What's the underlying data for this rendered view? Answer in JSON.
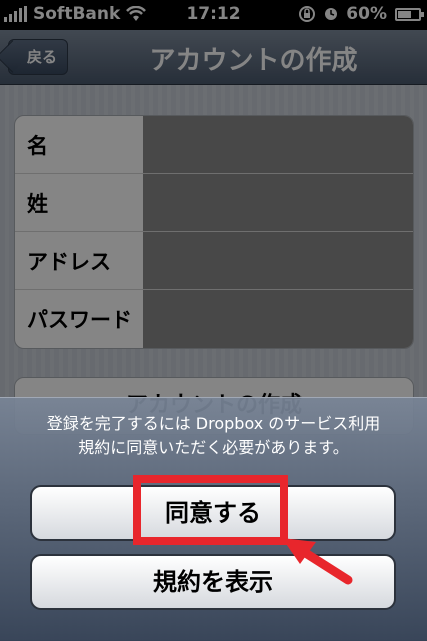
{
  "status_bar": {
    "carrier": "SoftBank",
    "time": "17:12",
    "battery_percent": "60%",
    "battery_level": 0.6,
    "signal_icon": "signal-bars-icon",
    "wifi_icon": "wifi-icon",
    "rotation_lock_icon": "rotation-lock-icon",
    "alarm_icon": "alarm-icon"
  },
  "nav": {
    "back_label": "戻る",
    "title": "アカウントの作成"
  },
  "form": {
    "rows": [
      {
        "label": "名",
        "value": ""
      },
      {
        "label": "姓",
        "value": ""
      },
      {
        "label": "アドレス",
        "value": ""
      },
      {
        "label": "パスワード",
        "value": ""
      }
    ],
    "create_button": "アカウントの作成"
  },
  "action_sheet": {
    "message_line1": "登録を完了するには Dropbox のサービス利用",
    "message_line2": "規約に同意いただく必要があります。",
    "agree_button": "同意する",
    "terms_button": "規約を表示"
  },
  "colors": {
    "annotation_red": "#e8262c",
    "nav_top": "#7e8b9c",
    "nav_bottom": "#4b5a6e"
  }
}
